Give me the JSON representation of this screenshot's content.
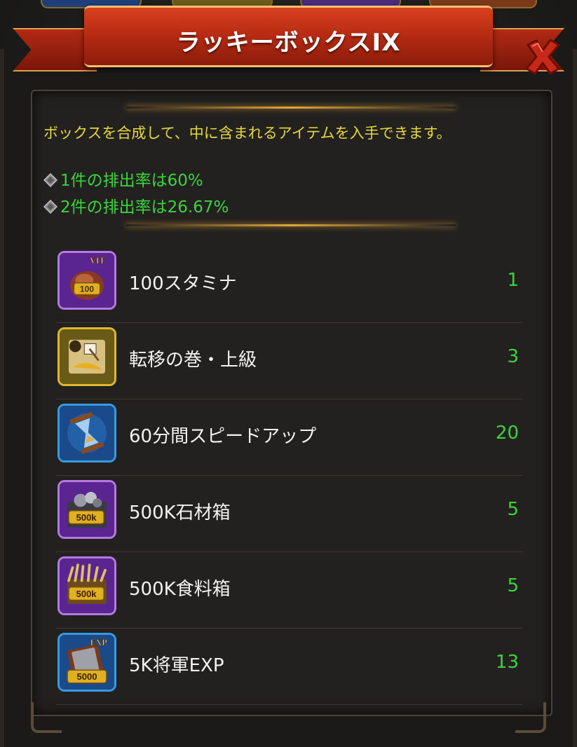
{
  "dialog": {
    "title": "ラッキーボックスIX"
  },
  "description": {
    "text": "ボックスを合成して、中に含まれるアイテムを入手できます。",
    "rates": [
      {
        "prefix": "1件の排出率は",
        "value": "60%"
      },
      {
        "prefix": "2件の排出率は",
        "value": "26.67%"
      }
    ]
  },
  "items": [
    {
      "name": "100スタミナ",
      "count": "1",
      "icon": "stamina-potion-icon",
      "badge": "100",
      "tag": "VIT",
      "frame_color": "#8a3fc0"
    },
    {
      "name": "転移の巻・上級",
      "count": "3",
      "icon": "teleport-scroll-icon",
      "badge": "",
      "tag": "",
      "frame_color": "#d0a020"
    },
    {
      "name": "60分間スピードアップ",
      "count": "20",
      "icon": "hourglass-icon",
      "badge": "",
      "tag": "",
      "frame_color": "#2a7ad0"
    },
    {
      "name": "500K石材箱",
      "count": "5",
      "icon": "stone-crate-icon",
      "badge": "500k",
      "tag": "",
      "frame_color": "#8a3fc0"
    },
    {
      "name": "500K食料箱",
      "count": "5",
      "icon": "food-crate-icon",
      "badge": "500k",
      "tag": "",
      "frame_color": "#8a3fc0"
    },
    {
      "name": "5K将軍EXP",
      "count": "13",
      "icon": "exp-book-icon",
      "badge": "5000",
      "tag": "EXP",
      "frame_color": "#2a7ad0"
    }
  ],
  "colors": {
    "description_yellow": "#e6d93a",
    "rate_green": "#3cd43c",
    "ribbon_red": "#b52a12",
    "close_red": "#c8281a"
  }
}
